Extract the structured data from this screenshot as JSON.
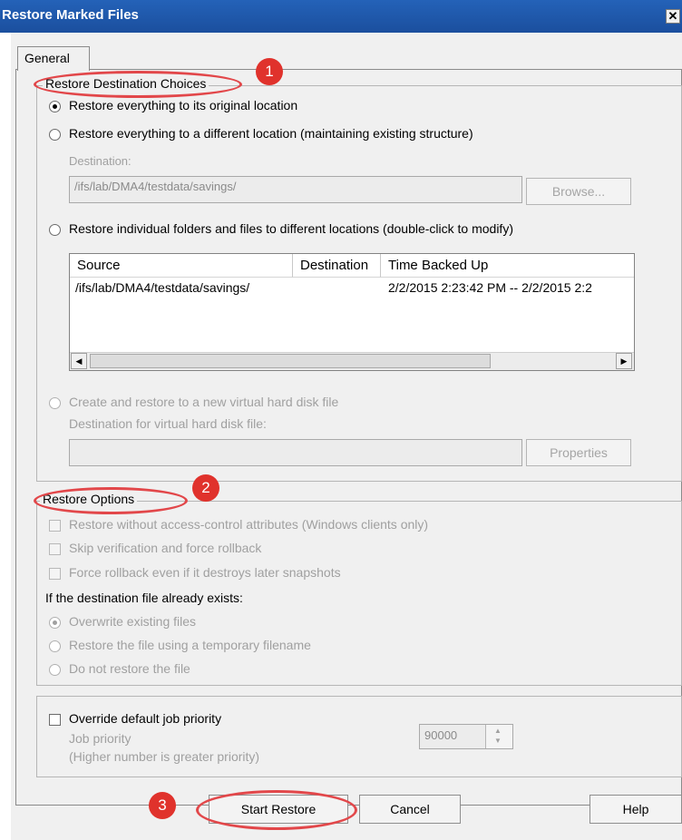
{
  "window": {
    "title": "Restore Marked Files",
    "close_glyph": "✕"
  },
  "tabs": [
    {
      "label": "General"
    }
  ],
  "destination_group": {
    "legend": "Restore Destination Choices",
    "option_original": "Restore everything to its original location",
    "option_different": "Restore everything to a different location (maintaining existing structure)",
    "destination_label": "Destination:",
    "destination_value": "/ifs/lab/DMA4/testdata/savings/",
    "browse_button": "Browse...",
    "option_individual": "Restore individual folders and files to different locations (double-click to modify)",
    "table": {
      "columns": [
        "Source",
        "Destination",
        "Time Backed Up"
      ],
      "rows": [
        {
          "source": "/ifs/lab/DMA4/testdata/savings/",
          "destination": "",
          "time": "2/2/2015 2:23:42 PM -- 2/2/2015 2:2"
        }
      ]
    },
    "option_vhd": "Create and restore to a new virtual hard disk file",
    "vhd_destination_label": "Destination for virtual hard disk file:",
    "vhd_destination_value": "",
    "properties_button": "Properties"
  },
  "restore_options": {
    "legend": "Restore Options",
    "check_acl": "Restore without access-control attributes (Windows clients only)",
    "check_skip": "Skip verification and force rollback",
    "check_force": "Force rollback even if it destroys later snapshots",
    "exists_label": "If the destination file already exists:",
    "radio_overwrite": "Overwrite existing files",
    "radio_temp": "Restore the file using a temporary filename",
    "radio_skip": "Do not restore the file"
  },
  "priority": {
    "override_label": "Override default job priority",
    "job_priority_label": "Job priority",
    "hint": "(Higher number is greater priority)",
    "value": "90000"
  },
  "buttons": {
    "start": "Start Restore",
    "cancel": "Cancel",
    "help": "Help"
  },
  "annotations": {
    "one": "1",
    "two": "2",
    "three": "3"
  },
  "icons": {
    "radio": "radio-button",
    "checkbox": "checkbox",
    "scroll_left": "◀",
    "scroll_right": "▶",
    "spin_up": "▲",
    "spin_down": "▼"
  },
  "colors": {
    "titlebar": "#1b4f9e",
    "annotation": "#e0322c"
  }
}
